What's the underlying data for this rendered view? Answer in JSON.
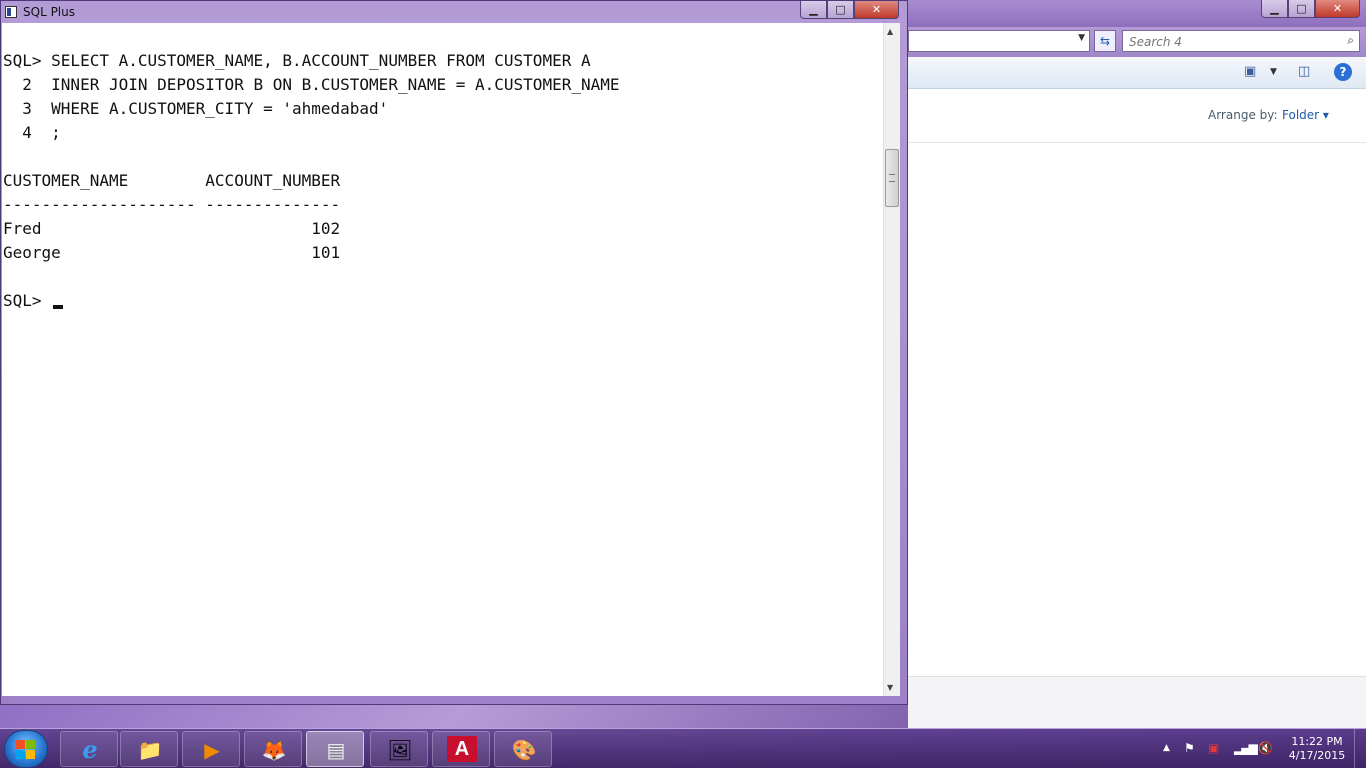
{
  "sqlplus": {
    "title": "SQL Plus",
    "console_lines": [
      "SQL> SELECT A.CUSTOMER_NAME, B.ACCOUNT_NUMBER FROM CUSTOMER A",
      "  2  INNER JOIN DEPOSITOR B ON B.CUSTOMER_NAME = A.CUSTOMER_NAME",
      "  3  WHERE A.CUSTOMER_CITY = 'ahmedabad'",
      "  4  ;",
      "",
      "CUSTOMER_NAME        ACCOUNT_NUMBER",
      "-------------------- --------------",
      "Fred                            102",
      "George                          101",
      "",
      "SQL> "
    ],
    "buttons": {
      "minimize": "▁",
      "maximize": "□",
      "close": "✕"
    }
  },
  "explorer": {
    "search_placeholder": "Search 4",
    "arrange_by_label": "Arrange by:",
    "folder_label": "Folder ▾",
    "help": "?",
    "buttons": {
      "minimize": "▁",
      "maximize": "□",
      "close": "✕"
    }
  },
  "taskbar": {
    "clock_time": "11:22 PM",
    "clock_date": "4/17/2015",
    "apps": [
      {
        "name": "internet-explorer-icon",
        "glyph": "e"
      },
      {
        "name": "windows-explorer-icon",
        "glyph": "📁"
      },
      {
        "name": "media-player-icon",
        "glyph": "▶"
      },
      {
        "name": "firefox-icon",
        "glyph": "🦊"
      },
      {
        "name": "sqlplus-icon",
        "glyph": "▤"
      },
      {
        "name": "photo-viewer-icon",
        "glyph": "🖼"
      },
      {
        "name": "adobe-reader-icon",
        "glyph": "A"
      },
      {
        "name": "paint-icon",
        "glyph": "🎨"
      }
    ],
    "tray": {
      "show_hidden": "▲",
      "action_center": "⚑",
      "network": "▮",
      "volume": "🔇"
    }
  }
}
